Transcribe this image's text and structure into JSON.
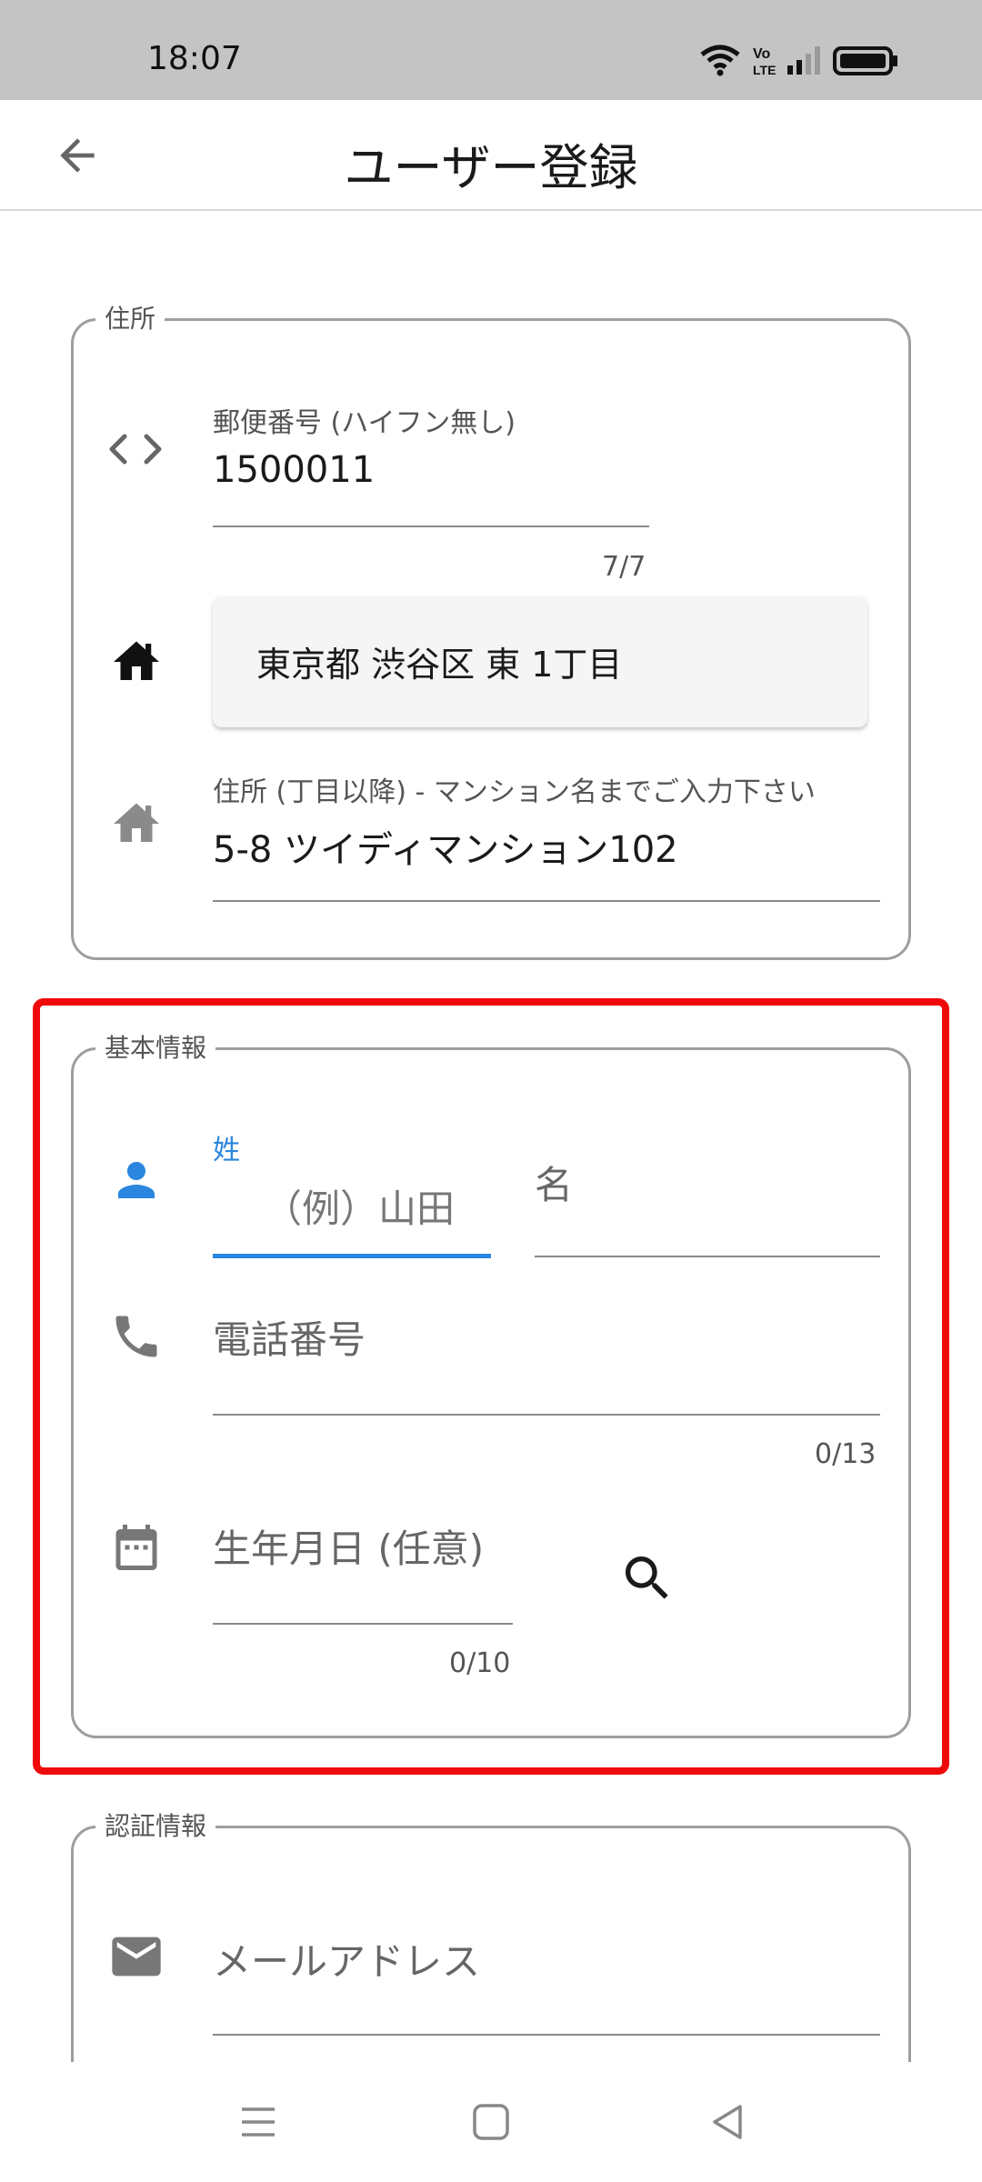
{
  "status_bar": {
    "time": "18:07",
    "icons": [
      "wifi-icon",
      "volte-icon",
      "signal-icon",
      "battery-icon"
    ]
  },
  "app_bar": {
    "title": "ユーザー登録",
    "back_icon": "arrow-back-icon"
  },
  "address_section": {
    "legend": "住所",
    "postal": {
      "label": "郵便番号 (ハイフン無し)",
      "value": "1500011",
      "counter": "7/7",
      "icon": "code-icon"
    },
    "address_result": {
      "value": "東京都 渋谷区 東 1丁目",
      "icon": "home-icon"
    },
    "address_detail": {
      "label": "住所 (丁目以降) - マンション名までご入力下さい",
      "value": "5-8 ツイディマンション102",
      "icon": "home-outline-icon"
    }
  },
  "basic_info_section": {
    "legend": "基本情報",
    "last_name": {
      "label": "姓",
      "placeholder": "（例）山田",
      "icon": "person-icon"
    },
    "first_name": {
      "placeholder": "名"
    },
    "phone": {
      "placeholder": "電話番号",
      "counter": "0/13",
      "icon": "phone-icon"
    },
    "birthday": {
      "placeholder": "生年月日 (任意)",
      "counter": "0/10",
      "icon": "calendar-icon",
      "search_icon": "search-icon"
    }
  },
  "auth_section": {
    "legend": "認証情報",
    "email": {
      "placeholder": "メールアドレス",
      "icon": "mail-icon"
    }
  },
  "nav_bar": {
    "buttons": [
      "menu-icon",
      "home-square-icon",
      "back-triangle-icon"
    ]
  },
  "colors": {
    "focus": "#2a86de",
    "highlight": "#ee0a0a",
    "status_bar": "#c4c4c4"
  }
}
